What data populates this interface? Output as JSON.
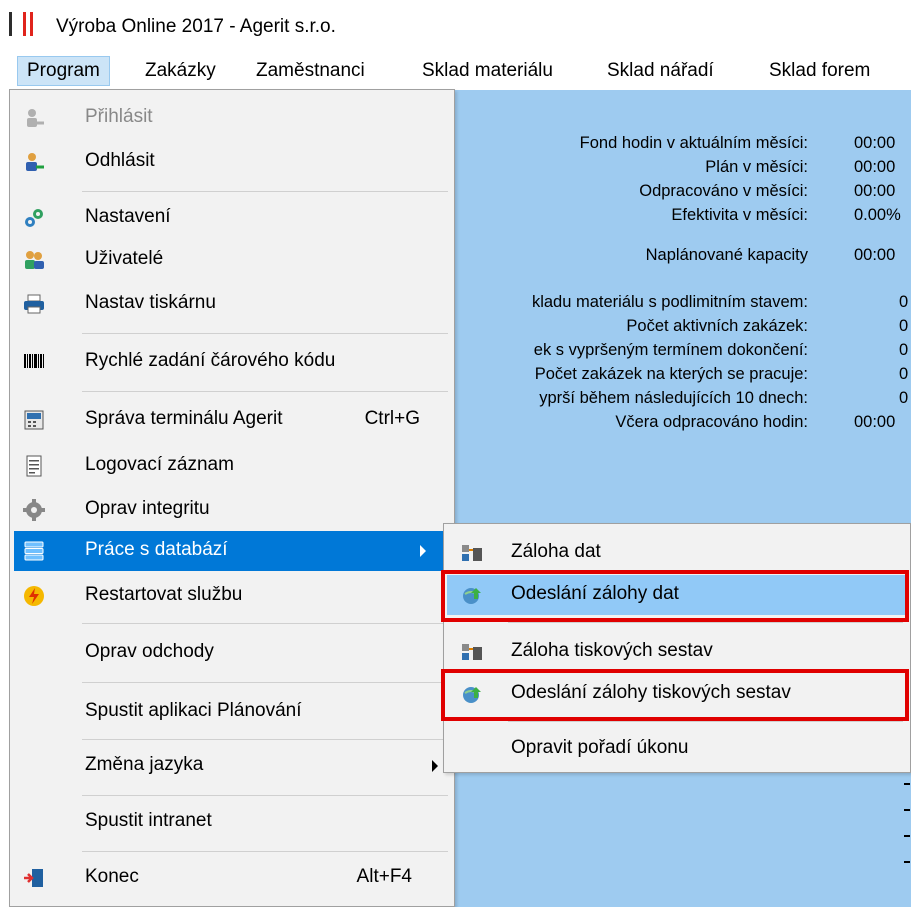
{
  "window": {
    "title": "Výroba Online 2017 - Agerit s.r.o."
  },
  "menubar": [
    {
      "label": "Program"
    },
    {
      "label": "Zakázky"
    },
    {
      "label": "Zaměstnanci"
    },
    {
      "label": "Sklad materiálu"
    },
    {
      "label": "Sklad nářadí"
    },
    {
      "label": "Sklad forem"
    }
  ],
  "program_menu": {
    "prihlasit": {
      "label": "Přihlásit",
      "icon": "login-user-icon"
    },
    "odhlasit": {
      "label": "Odhlásit",
      "icon": "logout-user-icon"
    },
    "nastaveni": {
      "label": "Nastavení",
      "icon": "settings-gears-icon"
    },
    "uzivatele": {
      "label": "Uživatelé",
      "icon": "users-icon"
    },
    "tiskarna": {
      "label": "Nastav tiskárnu",
      "icon": "printer-icon"
    },
    "carovy_kod": {
      "label": "Rychlé zadání čárového kódu",
      "icon": "barcode-icon"
    },
    "terminal": {
      "label": "Správa terminálu Agerit",
      "shortcut": "Ctrl+G",
      "icon": "terminal-icon"
    },
    "log": {
      "label": "Logovací záznam",
      "icon": "log-document-icon"
    },
    "integrita": {
      "label": "Oprav integritu",
      "icon": "gear-icon"
    },
    "databaze": {
      "label": "Práce s databází",
      "icon": "database-icon"
    },
    "restart": {
      "label": "Restartovat službu",
      "icon": "restart-service-icon"
    },
    "odchody": {
      "label": "Oprav odchody"
    },
    "planovani": {
      "label": "Spustit aplikaci Plánování"
    },
    "jazyk": {
      "label": "Změna jazyka"
    },
    "intranet": {
      "label": "Spustit intranet"
    },
    "konec": {
      "label": "Konec",
      "shortcut": "Alt+F4",
      "icon": "exit-door-icon"
    }
  },
  "database_submenu": {
    "zaloha": {
      "label": "Záloha dat",
      "icon": "backup-icon"
    },
    "odeslani": {
      "label": "Odeslání zálohy dat",
      "icon": "upload-globe-icon"
    },
    "zaloha_sestav": {
      "label": "Záloha tiskových sestav",
      "icon": "backup-icon"
    },
    "odeslani_sestav": {
      "label": "Odeslání zálohy tiskových sestav",
      "icon": "upload-globe-icon"
    },
    "poradi": {
      "label": "Opravit pořadí úkonu"
    }
  },
  "dashboard": {
    "fond_label": "Fond hodin v aktuálním měsíci:",
    "fond_value": "00:00",
    "plan_label": "Plán v měsíci:",
    "plan_value": "00:00",
    "odprac_label": "Odpracováno v měsíci:",
    "odprac_value": "00:00",
    "efekt_label": "Efektivita v měsíci:",
    "efekt_value": "0.00%",
    "kapac_label": "Naplánované kapacity",
    "kapac_value": "00:00",
    "sklad_label": "kladu materiálu s podlimitním stavem:",
    "sklad_value": "0",
    "aktivni_label": "Počet aktivních zakázek:",
    "aktivni_value": "0",
    "vyprseny_label": "ek s vypršeným termínem dokončení:",
    "vyprseny_value": "0",
    "pracuje_label": "Počet zakázek na kterých se pracuje:",
    "pracuje_value": "0",
    "vyprsi_label": "yprší během následujících 10 dnech:",
    "vyprsi_value": "0",
    "vcera_label": "Včera odpracováno hodin:",
    "vcera_value": "00:00"
  },
  "colors": {
    "highlight": "#0078d7",
    "dashboard_bg": "#9ecbf0",
    "annotation": "#e00000"
  }
}
